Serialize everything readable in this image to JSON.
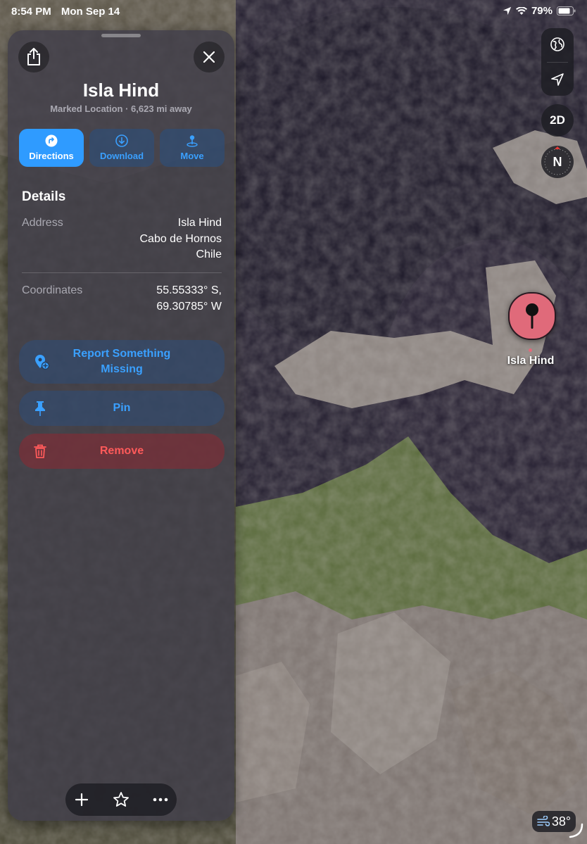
{
  "status_bar": {
    "time": "8:54 PM",
    "date": "Mon Sep 14",
    "battery": "79%",
    "icons": [
      "location-arrow-icon",
      "wifi-icon",
      "battery-icon"
    ]
  },
  "map_controls": {
    "globe_icon": "globe-icon",
    "locate_icon": "location-arrow-icon",
    "view_mode": "2D",
    "compass": "N"
  },
  "map_pin": {
    "label": "Isla Hind",
    "color": "#e06a7a",
    "icon": "pin-icon"
  },
  "weather": {
    "temperature": "38°",
    "icon": "wind-icon"
  },
  "sheet": {
    "title": "Isla Hind",
    "subtitle": "Marked Location · 6,623 mi away",
    "share_icon": "share-icon",
    "close_icon": "close-icon",
    "actions": [
      {
        "label": "Directions",
        "icon": "directions-icon"
      },
      {
        "label": "Download",
        "icon": "download-icon"
      },
      {
        "label": "Move",
        "icon": "move-pin-icon"
      }
    ],
    "details": {
      "title": "Details",
      "address_label": "Address",
      "address_line1": "Isla Hind",
      "address_line2": "Cabo de Hornos",
      "address_line3": "Chile",
      "coordinates_label": "Coordinates",
      "coordinates_line1": "55.55333° S,",
      "coordinates_line2": "69.30785° W"
    },
    "buttons": {
      "report_line1": "Report Something",
      "report_line2": "Missing",
      "pin": "Pin",
      "remove": "Remove"
    },
    "toolbar": [
      "plus-icon",
      "star-icon",
      "more-icon"
    ],
    "accent_color": "#2f9bff",
    "danger_color": "#ff5a5a"
  }
}
